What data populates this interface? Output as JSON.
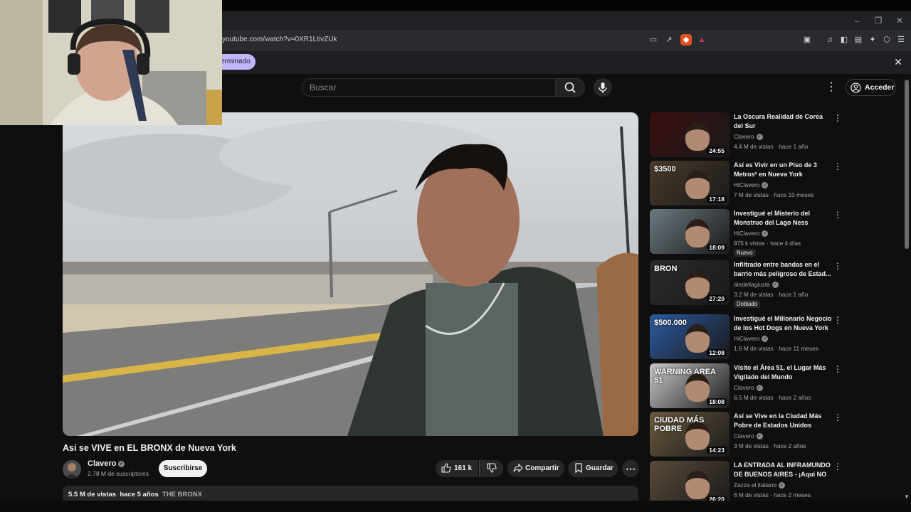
{
  "browser": {
    "url": "youtube.com/watch?v=0XR1LtivZUk",
    "infobar_chip": "erminado",
    "close": "✕"
  },
  "header": {
    "search_placeholder": "Buscar",
    "signin_label": "Acceder"
  },
  "video": {
    "title": "Así se VIVE en EL BRONX de Nueva York",
    "channel": "Clavero",
    "subscribers": "2.78 M de suscriptores",
    "subscribe_label": "Suscribirse",
    "likes": "161 k",
    "share_label": "Compartir",
    "save_label": "Guardar",
    "views": "5.5 M de vistas",
    "age": "hace 5 años",
    "hashtag": "THE BRONX"
  },
  "recommendations": [
    {
      "title": "La Oscura Realidad de Corea del Sur",
      "channel": "Clavero",
      "views": "4.4 M de vistas",
      "age": "hace 1 año",
      "duration": "24:55",
      "badge": "",
      "thumb_color": "#3b0d10"
    },
    {
      "title": "Así es Vivir en un Piso de 3 Metros² en Nueva York",
      "channel": "HiClavero",
      "views": "7 M de vistas",
      "age": "hace 10 meses",
      "duration": "17:18",
      "badge": "",
      "thumb_color": "#4a3a2a",
      "thumb_text": "$3500"
    },
    {
      "title": "Investigué el Misterio del Monstruo del Lago Ness",
      "channel": "HiClavero",
      "views": "975 k vistas",
      "age": "hace 4 días",
      "duration": "18:09",
      "badge": "Nuevo",
      "thumb_color": "#6b7a80"
    },
    {
      "title": "Infiltrado entre bandas en el barrio más peligroso de Estad...",
      "channel": "aledellagiusta",
      "views": "3.2 M de vistas",
      "age": "hace 1 año",
      "duration": "27:20",
      "badge": "Doblado",
      "thumb_color": "#2b2b2b",
      "thumb_text": "BRON"
    },
    {
      "title": "Investigué el Millonario Negocio de los Hot Dogs en Nueva York",
      "channel": "HiClavero",
      "views": "1.6 M de vistas",
      "age": "hace 11 meses",
      "duration": "12:08",
      "badge": "",
      "thumb_color": "#2c5aa0",
      "thumb_text": "$500.000"
    },
    {
      "title": "Visito el Área 51, el Lugar Más Vigilado del Mundo",
      "channel": "Clavero",
      "views": "6.5 M de vistas",
      "age": "hace 2 años",
      "duration": "18:08",
      "badge": "",
      "thumb_color": "#c9c9c9",
      "thumb_text": "WARNING AREA 51"
    },
    {
      "title": "Así se Vive en la Ciudad Más Pobre de Estados Unidos",
      "channel": "Clavero",
      "views": "3 M de vistas",
      "age": "hace 2 años",
      "duration": "14:23",
      "badge": "",
      "thumb_color": "#6b5a3e",
      "thumb_text": "CIUDAD MÁS POBRE"
    },
    {
      "title": "LA ENTRADA AL INFRAMUNDO DE BUENOS AIRES - ¡Aquí NO ...",
      "channel": "Zazza el italiano",
      "views": "6 M de vistas",
      "age": "hace 2 meses",
      "duration": "26:20",
      "badge": "",
      "thumb_color": "#5a4a3a"
    }
  ]
}
